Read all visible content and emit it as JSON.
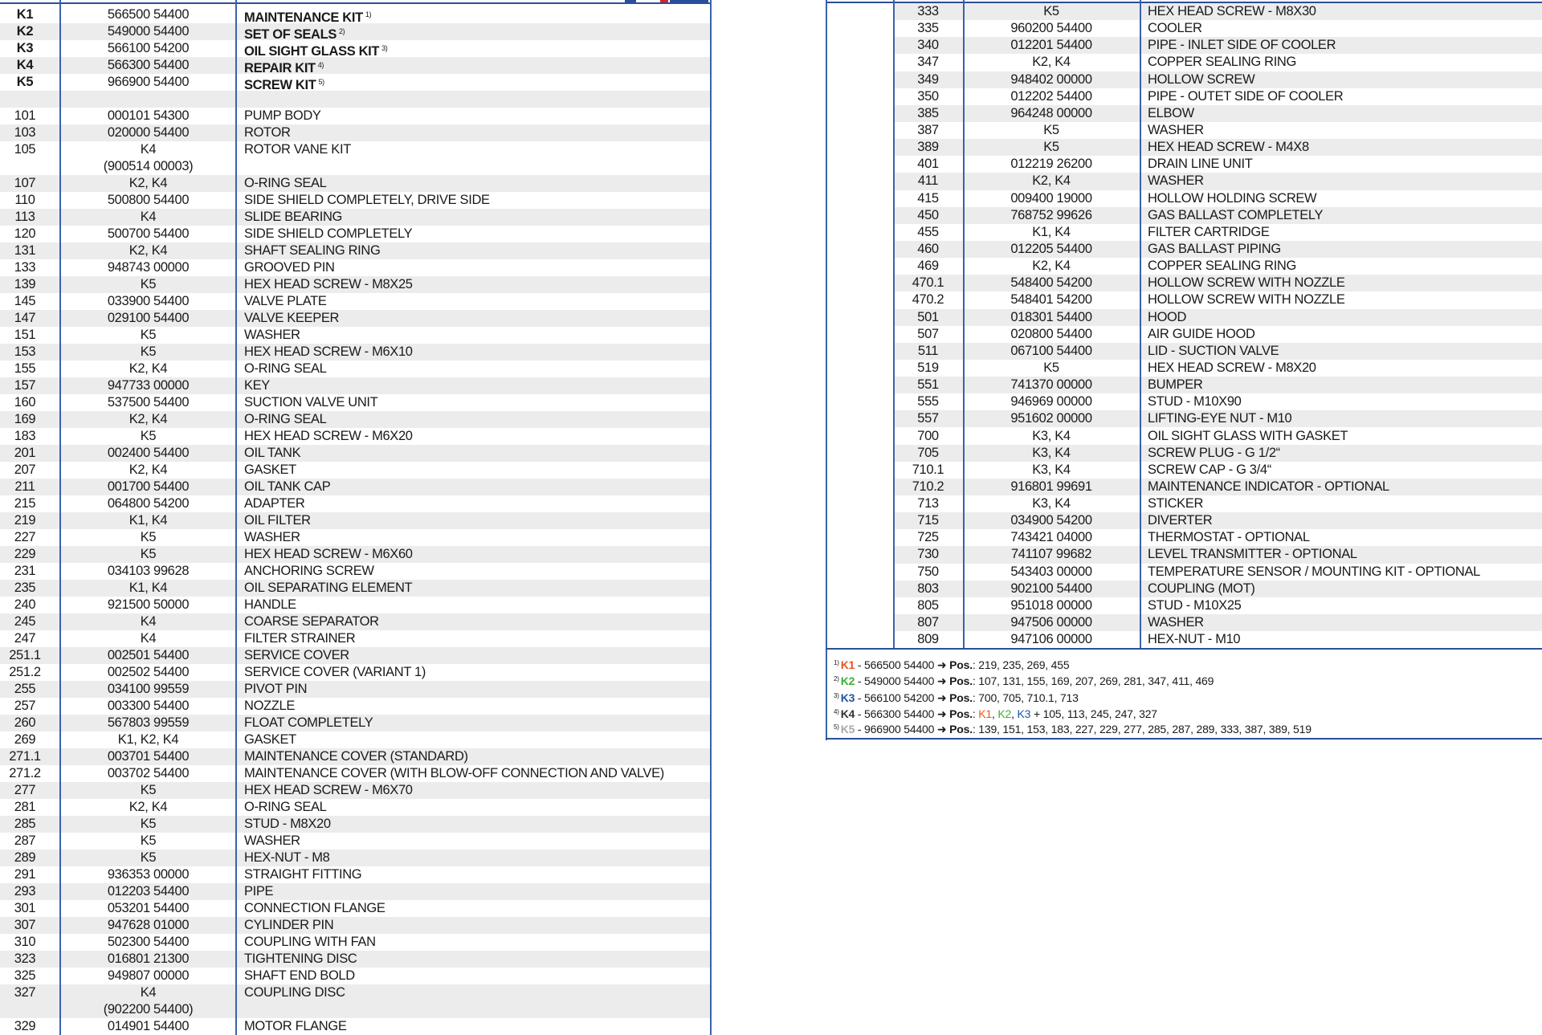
{
  "colors": {
    "border": "#2a4f9a",
    "stripe": "#ececec",
    "k1": "#e8561e",
    "k2": "#3db133",
    "k3": "#1f55a8",
    "k5": "#a9a9a9"
  },
  "left_table": {
    "rows": [
      {
        "pos": "K1",
        "part": "566500 54400",
        "desc": "MAINTENANCE KIT",
        "note": "1)",
        "bold": true
      },
      {
        "pos": "K2",
        "part": "549000 54400",
        "desc": "SET OF SEALS",
        "note": "2)",
        "bold": true
      },
      {
        "pos": "K3",
        "part": "566100 54200",
        "desc": "OIL SIGHT GLASS KIT",
        "note": "3)",
        "bold": true
      },
      {
        "pos": "K4",
        "part": "566300 54400",
        "desc": "REPAIR KIT",
        "note": "4)",
        "bold": true
      },
      {
        "pos": "K5",
        "part": "966900 54400",
        "desc": "SCREW KIT",
        "note": "5)",
        "bold": true
      },
      {
        "pos": "",
        "part": "",
        "desc": ""
      },
      {
        "pos": "101",
        "part": "000101 54300",
        "desc": "PUMP BODY"
      },
      {
        "pos": "103",
        "part": "020000 54400",
        "desc": "ROTOR"
      },
      {
        "pos": "105",
        "part": "K4",
        "part2": "(900514 00003)",
        "desc": "ROTOR VANE KIT"
      },
      {
        "pos": "107",
        "part": "K2, K4",
        "desc": "O-RING SEAL"
      },
      {
        "pos": "110",
        "part": "500800 54400",
        "desc": "SIDE SHIELD COMPLETELY, DRIVE SIDE"
      },
      {
        "pos": "113",
        "part": "K4",
        "desc": "SLIDE BEARING"
      },
      {
        "pos": "120",
        "part": "500700 54400",
        "desc": "SIDE SHIELD COMPLETELY"
      },
      {
        "pos": "131",
        "part": "K2, K4",
        "desc": "SHAFT SEALING RING"
      },
      {
        "pos": "133",
        "part": "948743 00000",
        "desc": "GROOVED PIN"
      },
      {
        "pos": "139",
        "part": "K5",
        "desc": "HEX HEAD SCREW - M8X25"
      },
      {
        "pos": "145",
        "part": "033900 54400",
        "desc": "VALVE PLATE"
      },
      {
        "pos": "147",
        "part": "029100 54400",
        "desc": "VALVE KEEPER"
      },
      {
        "pos": "151",
        "part": "K5",
        "desc": "WASHER"
      },
      {
        "pos": "153",
        "part": "K5",
        "desc": "HEX HEAD SCREW - M6X10"
      },
      {
        "pos": "155",
        "part": "K2, K4",
        "desc": "O-RING SEAL"
      },
      {
        "pos": "157",
        "part": "947733 00000",
        "desc": "KEY"
      },
      {
        "pos": "160",
        "part": "537500 54400",
        "desc": "SUCTION VALVE UNIT"
      },
      {
        "pos": "169",
        "part": "K2, K4",
        "desc": "O-RING SEAL"
      },
      {
        "pos": "183",
        "part": "K5",
        "desc": "HEX HEAD SCREW - M6X20"
      },
      {
        "pos": "201",
        "part": "002400 54400",
        "desc": "OIL TANK"
      },
      {
        "pos": "207",
        "part": "K2, K4",
        "desc": "GASKET"
      },
      {
        "pos": "211",
        "part": "001700 54400",
        "desc": "OIL TANK CAP"
      },
      {
        "pos": "215",
        "part": "064800 54200",
        "desc": "ADAPTER"
      },
      {
        "pos": "219",
        "part": "K1, K4",
        "desc": "OIL FILTER"
      },
      {
        "pos": "227",
        "part": "K5",
        "desc": "WASHER"
      },
      {
        "pos": "229",
        "part": "K5",
        "desc": "HEX HEAD SCREW - M6X60"
      },
      {
        "pos": "231",
        "part": "034103 99628",
        "desc": "ANCHORING SCREW"
      },
      {
        "pos": "235",
        "part": "K1, K4",
        "desc": "OIL SEPARATING ELEMENT"
      },
      {
        "pos": "240",
        "part": "921500 50000",
        "desc": "HANDLE"
      },
      {
        "pos": "245",
        "part": "K4",
        "desc": "COARSE SEPARATOR"
      },
      {
        "pos": "247",
        "part": "K4",
        "desc": "FILTER STRAINER"
      },
      {
        "pos": "251.1",
        "part": "002501 54400",
        "desc": "SERVICE COVER"
      },
      {
        "pos": "251.2",
        "part": "002502 54400",
        "desc": "SERVICE COVER (VARIANT 1)"
      },
      {
        "pos": "255",
        "part": "034100 99559",
        "desc": "PIVOT PIN"
      },
      {
        "pos": "257",
        "part": "003300 54400",
        "desc": "NOZZLE"
      },
      {
        "pos": "260",
        "part": "567803 99559",
        "desc": "FLOAT COMPLETELY"
      },
      {
        "pos": "269",
        "part": "K1, K2, K4",
        "desc": "GASKET"
      },
      {
        "pos": "271.1",
        "part": "003701 54400",
        "desc": "MAINTENANCE COVER (STANDARD)"
      },
      {
        "pos": "271.2",
        "part": "003702 54400",
        "desc": "MAINTENANCE COVER (WITH BLOW-OFF CONNECTION AND VALVE)"
      },
      {
        "pos": "277",
        "part": "K5",
        "desc": "HEX HEAD SCREW - M6X70"
      },
      {
        "pos": "281",
        "part": "K2, K4",
        "desc": "O-RING SEAL"
      },
      {
        "pos": "285",
        "part": "K5",
        "desc": "STUD - M8X20"
      },
      {
        "pos": "287",
        "part": "K5",
        "desc": "WASHER"
      },
      {
        "pos": "289",
        "part": "K5",
        "desc": "HEX-NUT - M8"
      },
      {
        "pos": "291",
        "part": "936353 00000",
        "desc": "STRAIGHT FITTING"
      },
      {
        "pos": "293",
        "part": "012203 54400",
        "desc": "PIPE"
      },
      {
        "pos": "301",
        "part": "053201 54400",
        "desc": "CONNECTION FLANGE"
      },
      {
        "pos": "307",
        "part": "947628 01000",
        "desc": "CYLINDER PIN"
      },
      {
        "pos": "310",
        "part": "502300 54400",
        "desc": "COUPLING WITH FAN"
      },
      {
        "pos": "323",
        "part": "016801 21300",
        "desc": "TIGHTENING DISC"
      },
      {
        "pos": "325",
        "part": "949807 00000",
        "desc": "SHAFT END BOLD"
      },
      {
        "pos": "327",
        "part": "K4",
        "part2": "(902200 54400)",
        "desc": "COUPLING DISC"
      },
      {
        "pos": "329",
        "part": "014901 54400",
        "desc": "MOTOR FLANGE"
      }
    ]
  },
  "right_table": {
    "rows": [
      {
        "pos": "333",
        "part": "K5",
        "desc": "HEX HEAD SCREW - M8X30"
      },
      {
        "pos": "335",
        "part": "960200 54400",
        "desc": "COOLER"
      },
      {
        "pos": "340",
        "part": "012201 54400",
        "desc": "PIPE - INLET SIDE OF COOLER"
      },
      {
        "pos": "347",
        "part": "K2, K4",
        "desc": "COPPER SEALING RING"
      },
      {
        "pos": "349",
        "part": "948402 00000",
        "desc": "HOLLOW SCREW"
      },
      {
        "pos": "350",
        "part": "012202 54400",
        "desc": "PIPE - OUTET SIDE OF COOLER"
      },
      {
        "pos": "385",
        "part": "964248 00000",
        "desc": "ELBOW"
      },
      {
        "pos": "387",
        "part": "K5",
        "desc": "WASHER"
      },
      {
        "pos": "389",
        "part": "K5",
        "desc": "HEX HEAD SCREW - M4X8"
      },
      {
        "pos": "401",
        "part": "012219 26200",
        "desc": "DRAIN LINE UNIT"
      },
      {
        "pos": "411",
        "part": "K2, K4",
        "desc": "WASHER"
      },
      {
        "pos": "415",
        "part": "009400 19000",
        "desc": "HOLLOW HOLDING SCREW"
      },
      {
        "pos": "450",
        "part": "768752 99626",
        "desc": "GAS BALLAST COMPLETELY"
      },
      {
        "pos": "455",
        "part": "K1, K4",
        "desc": "FILTER CARTRIDGE"
      },
      {
        "pos": "460",
        "part": "012205 54400",
        "desc": "GAS BALLAST PIPING"
      },
      {
        "pos": "469",
        "part": "K2, K4",
        "desc": "COPPER SEALING RING"
      },
      {
        "pos": "470.1",
        "part": "548400 54200",
        "desc": "HOLLOW SCREW WITH NOZZLE"
      },
      {
        "pos": "470.2",
        "part": "548401 54200",
        "desc": "HOLLOW SCREW WITH NOZZLE"
      },
      {
        "pos": "501",
        "part": "018301 54400",
        "desc": "HOOD"
      },
      {
        "pos": "507",
        "part": "020800 54400",
        "desc": "AIR GUIDE HOOD"
      },
      {
        "pos": "511",
        "part": "067100 54400",
        "desc": "LID - SUCTION VALVE"
      },
      {
        "pos": "519",
        "part": "K5",
        "desc": "HEX HEAD SCREW - M8X20"
      },
      {
        "pos": "551",
        "part": "741370 00000",
        "desc": "BUMPER"
      },
      {
        "pos": "555",
        "part": "946969 00000",
        "desc": "STUD - M10X90"
      },
      {
        "pos": "557",
        "part": "951602 00000",
        "desc": "LIFTING-EYE NUT - M10"
      },
      {
        "pos": "700",
        "part": "K3, K4",
        "desc": "OIL SIGHT GLASS WITH GASKET"
      },
      {
        "pos": "705",
        "part": "K3, K4",
        "desc": "SCREW PLUG - G 1/2“"
      },
      {
        "pos": "710.1",
        "part": "K3, K4",
        "desc": "SCREW CAP - G 3/4“"
      },
      {
        "pos": "710.2",
        "part": "916801 99691",
        "desc": "MAINTENANCE INDICATOR - OPTIONAL"
      },
      {
        "pos": "713",
        "part": "K3, K4",
        "desc": "STICKER"
      },
      {
        "pos": "715",
        "part": "034900 54200",
        "desc": "DIVERTER"
      },
      {
        "pos": "725",
        "part": "743421 04000",
        "desc": "THERMOSTAT - OPTIONAL"
      },
      {
        "pos": "730",
        "part": "741107 99682",
        "desc": "LEVEL TRANSMITTER - OPTIONAL"
      },
      {
        "pos": "750",
        "part": "543403 00000",
        "desc": "TEMPERATURE SENSOR / MOUNTING KIT - OPTIONAL"
      },
      {
        "pos": "803",
        "part": "902100 54400",
        "desc": "COUPLING (MOT)"
      },
      {
        "pos": "805",
        "part": "951018 00000",
        "desc": "STUD - M10X25"
      },
      {
        "pos": "807",
        "part": "947506 00000",
        "desc": "WASHER"
      },
      {
        "pos": "809",
        "part": "947106 00000",
        "desc": "HEX-NUT - M10"
      }
    ]
  },
  "footnotes": [
    {
      "num": "1)",
      "kit": "K1",
      "kit_color": "#e8561e",
      "part": " - 566500 54400 ",
      "arrow": "➜",
      "pos_label": "Pos.",
      "refs": [],
      "list": ": 219, 235, 269, 455"
    },
    {
      "num": "2)",
      "kit": "K2",
      "kit_color": "#3db133",
      "part": " - 549000 54400 ",
      "arrow": "➜",
      "pos_label": "Pos.",
      "refs": [],
      "list": ": 107, 131, 155, 169, 207, 269, 281, 347, 411, 469"
    },
    {
      "num": "3)",
      "kit": "K3",
      "kit_color": "#1f55a8",
      "part": " - 566100 54200 ",
      "arrow": "➜",
      "pos_label": "Pos.",
      "refs": [],
      "list": ": 700, 705, 710.1, 713"
    },
    {
      "num": "4)",
      "kit": "K4",
      "kit_color": "#333333",
      "part": " - 566300 54400 ",
      "arrow": "➜",
      "pos_label": "Pos.",
      "refs": [
        {
          "t": "K1",
          "c": "#e8561e"
        },
        {
          "t": "K2",
          "c": "#3db133"
        },
        {
          "t": "K3",
          "c": "#1f55a8"
        }
      ],
      "list": " + 105, 113, 245, 247, 327"
    },
    {
      "num": "5)",
      "kit": "K5",
      "kit_color": "#a9a9a9",
      "part": " - 966900 54400 ",
      "arrow": "➜",
      "pos_label": "Pos.",
      "refs": [],
      "list": ": 139, 151, 153, 183, 227, 229, 277, 285, 287, 289, 333, 387, 389, 519"
    }
  ]
}
